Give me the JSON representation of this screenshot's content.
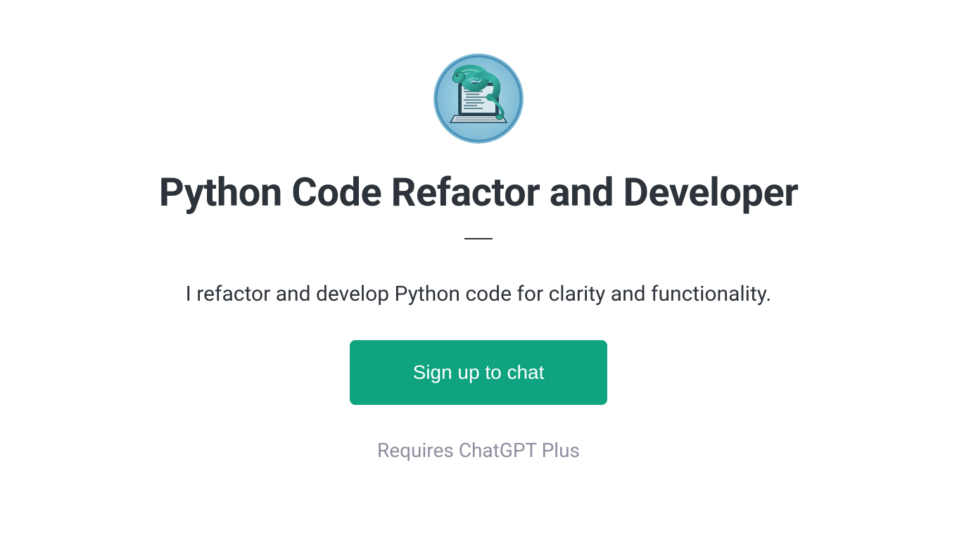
{
  "title": "Python Code Refactor and Developer",
  "description": "I refactor and develop Python code for clarity and functionality.",
  "signup_button_label": "Sign up to chat",
  "requires_text": "Requires ChatGPT Plus"
}
